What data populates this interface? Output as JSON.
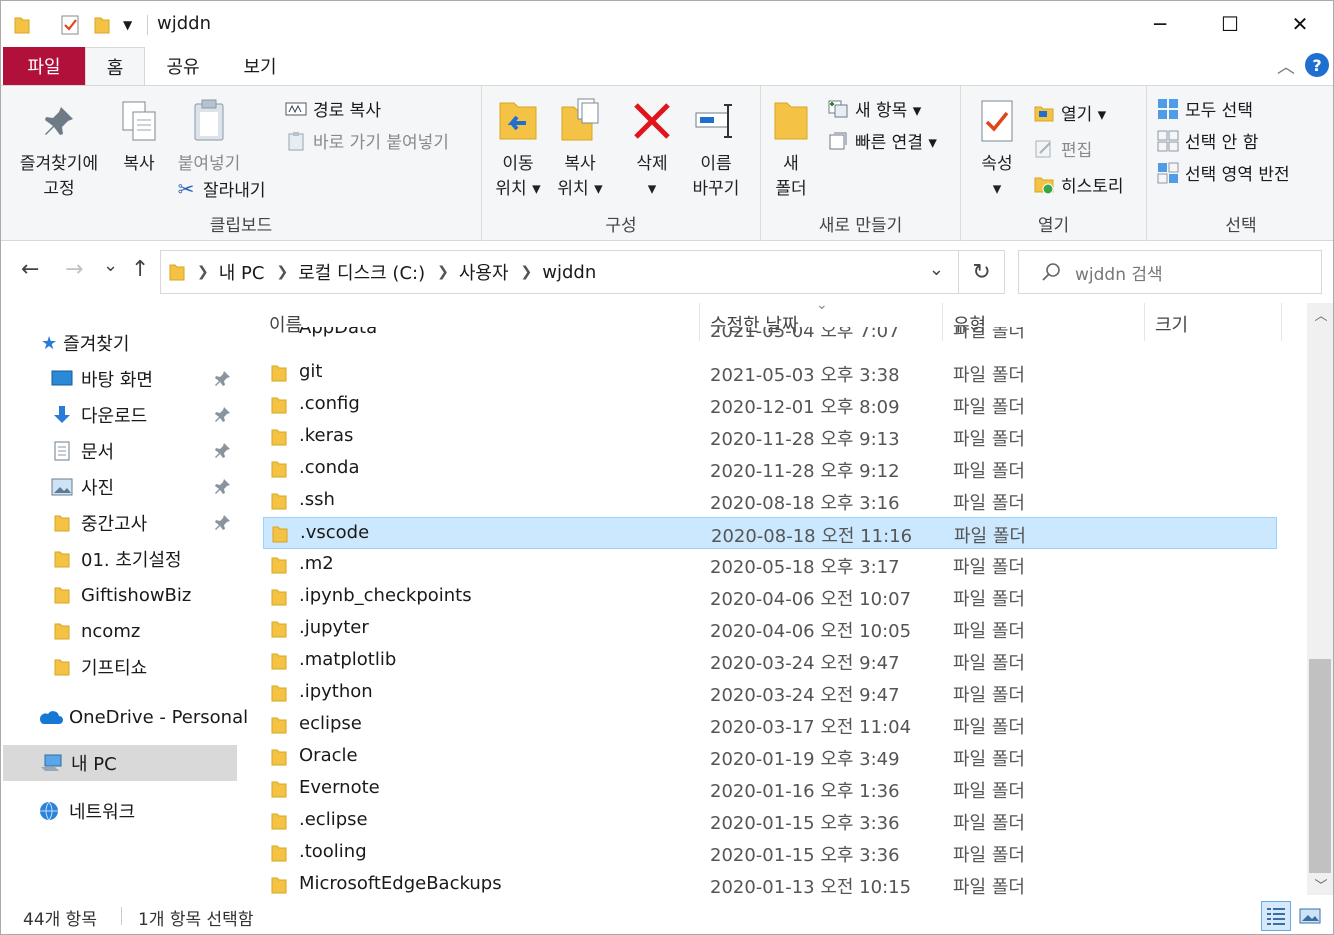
{
  "window": {
    "title": "wjddn",
    "controls": {
      "minimize": "─",
      "maximize": "☐",
      "close": "✕"
    }
  },
  "ribbon_tabs": [
    "파일",
    "홈",
    "공유",
    "보기"
  ],
  "ribbon": {
    "clipboard": {
      "pin_line1": "즐겨찾기에",
      "pin_line2": "고정",
      "copy": "복사",
      "paste": "붙여넣기",
      "copy_path": "경로 복사",
      "paste_shortcut": "바로 가기 붙여넣기",
      "cut": "잘라내기",
      "label": "클립보드"
    },
    "organize": {
      "move_line1": "이동",
      "move_line2": "위치 ▾",
      "copyto_line1": "복사",
      "copyto_line2": "위치 ▾",
      "delete_line1": "삭제",
      "delete_line2": "▾",
      "rename_line1": "이름",
      "rename_line2": "바꾸기",
      "label": "구성"
    },
    "new": {
      "folder_line1": "새",
      "folder_line2": "폴더",
      "new_item": "새 항목 ▾",
      "easy_access": "빠른 연결 ▾",
      "label": "새로 만들기"
    },
    "open": {
      "props_line1": "속성",
      "props_line2": "▾",
      "open": "열기 ▾",
      "edit": "편집",
      "history": "히스토리",
      "label": "열기"
    },
    "select": {
      "select_all": "모두 선택",
      "select_none": "선택 안 함",
      "invert": "선택 영역 반전",
      "label": "선택"
    }
  },
  "nav": {
    "back": "←",
    "forward": "→",
    "recent": "⌄",
    "up": "↑",
    "breadcrumb": [
      "내 PC",
      "로컬 디스크 (C:)",
      "사용자",
      "wjddn"
    ],
    "dropdown": "⌄",
    "refresh": "↻",
    "search_placeholder": "wjddn 검색"
  },
  "sidebar": {
    "quick_access": "즐겨찾기",
    "items": [
      {
        "label": "바탕 화면",
        "pinned": true
      },
      {
        "label": "다운로드",
        "pinned": true
      },
      {
        "label": "문서",
        "pinned": true
      },
      {
        "label": "사진",
        "pinned": true
      },
      {
        "label": "중간고사",
        "pinned": true
      },
      {
        "label": "01. 초기설정",
        "pinned": false
      },
      {
        "label": "GiftishowBiz",
        "pinned": false
      },
      {
        "label": "ncomz",
        "pinned": false
      },
      {
        "label": "기프티쇼",
        "pinned": false
      }
    ],
    "onedrive": "OneDrive - Personal",
    "this_pc": "내 PC",
    "network": "네트워크"
  },
  "columns": {
    "name": "이름",
    "date": "수정한 날짜",
    "type": "유형",
    "size": "크기"
  },
  "partial_row": {
    "name": "AppData",
    "date": "2021-05-04 오후 7:07",
    "type": "파일 폴더"
  },
  "files": [
    {
      "name": "git",
      "date": "2021-05-03 오후 3:38",
      "type": "파일 폴더",
      "selected": false
    },
    {
      "name": ".config",
      "date": "2020-12-01 오후 8:09",
      "type": "파일 폴더",
      "selected": false
    },
    {
      "name": ".keras",
      "date": "2020-11-28 오후 9:13",
      "type": "파일 폴더",
      "selected": false
    },
    {
      "name": ".conda",
      "date": "2020-11-28 오후 9:12",
      "type": "파일 폴더",
      "selected": false
    },
    {
      "name": ".ssh",
      "date": "2020-08-18 오후 3:16",
      "type": "파일 폴더",
      "selected": false
    },
    {
      "name": ".vscode",
      "date": "2020-08-18 오전 11:16",
      "type": "파일 폴더",
      "selected": true
    },
    {
      "name": ".m2",
      "date": "2020-05-18 오후 3:17",
      "type": "파일 폴더",
      "selected": false
    },
    {
      "name": ".ipynb_checkpoints",
      "date": "2020-04-06 오전 10:07",
      "type": "파일 폴더",
      "selected": false
    },
    {
      "name": ".jupyter",
      "date": "2020-04-06 오전 10:05",
      "type": "파일 폴더",
      "selected": false
    },
    {
      "name": ".matplotlib",
      "date": "2020-03-24 오전 9:47",
      "type": "파일 폴더",
      "selected": false
    },
    {
      "name": ".ipython",
      "date": "2020-03-24 오전 9:47",
      "type": "파일 폴더",
      "selected": false
    },
    {
      "name": "eclipse",
      "date": "2020-03-17 오전 11:04",
      "type": "파일 폴더",
      "selected": false
    },
    {
      "name": "Oracle",
      "date": "2020-01-19 오후 3:49",
      "type": "파일 폴더",
      "selected": false
    },
    {
      "name": "Evernote",
      "date": "2020-01-16 오후 1:36",
      "type": "파일 폴더",
      "selected": false
    },
    {
      "name": ".eclipse",
      "date": "2020-01-15 오후 3:36",
      "type": "파일 폴더",
      "selected": false
    },
    {
      "name": ".tooling",
      "date": "2020-01-15 오후 3:36",
      "type": "파일 폴더",
      "selected": false
    },
    {
      "name": "MicrosoftEdgeBackups",
      "date": "2020-01-13 오전 10:15",
      "type": "파일 폴더",
      "selected": false
    }
  ],
  "status": {
    "count": "44개 항목",
    "selection": "1개 항목 선택함"
  },
  "colors": {
    "file_tab": "#b0103a",
    "selection": "#cce8ff",
    "folder": "#f4c244",
    "accent": "#1f6fd0"
  }
}
